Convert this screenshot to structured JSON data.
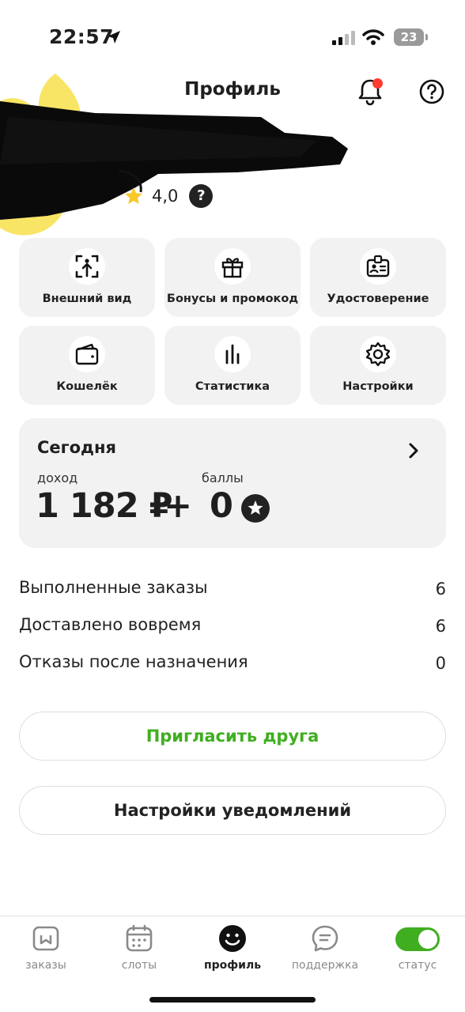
{
  "status_bar": {
    "time": "22:57",
    "battery": "23"
  },
  "header": {
    "title": "Профиль"
  },
  "profile": {
    "rating": "4,0",
    "rating_help": "?"
  },
  "tiles": [
    {
      "label": "Внешний вид",
      "icon": "person-upload-icon"
    },
    {
      "label": "Бонусы и промокод",
      "icon": "gift-icon"
    },
    {
      "label": "Удостоверение",
      "icon": "id-badge-icon"
    },
    {
      "label": "Кошелёк",
      "icon": "wallet-icon"
    },
    {
      "label": "Статистика",
      "icon": "bar-chart-icon"
    },
    {
      "label": "Настройки",
      "icon": "gear-icon"
    }
  ],
  "today": {
    "title": "Сегодня",
    "income_label": "доход",
    "points_label": "баллы",
    "income_value": "1 182 ₽",
    "plus": "+",
    "points_value": "0"
  },
  "stats": [
    {
      "label": "Выполненные заказы",
      "value": "6"
    },
    {
      "label": "Доставлено вовремя",
      "value": "6"
    },
    {
      "label": "Отказы после назначения",
      "value": "0"
    }
  ],
  "buttons": {
    "invite": "Пригласить друга",
    "notifications": "Настройки уведомлений"
  },
  "tabbar": [
    {
      "label": "заказы",
      "icon": "orders-box-icon",
      "active": false
    },
    {
      "label": "слоты",
      "icon": "calendar-icon",
      "active": false
    },
    {
      "label": "профиль",
      "icon": "smiley-icon",
      "active": true
    },
    {
      "label": "поддержка",
      "icon": "chat-bubble-icon",
      "active": false
    },
    {
      "label": "статус",
      "icon": "status-toggle",
      "active": false
    }
  ],
  "colors": {
    "accent_green": "#3fae1f",
    "notification_dot": "#ff3b30",
    "tile_bg": "#f2f2f2",
    "star_yellow": "#f7c928"
  }
}
